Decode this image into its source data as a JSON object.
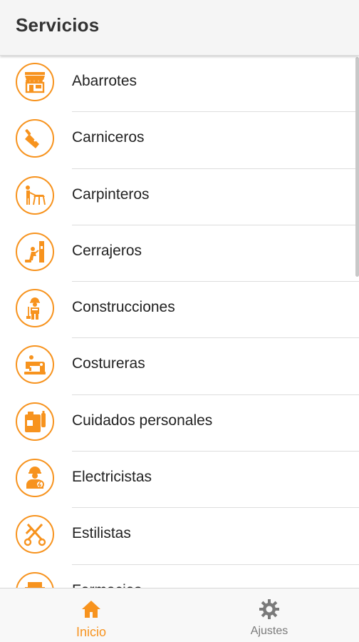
{
  "app": {
    "title": "Servicios"
  },
  "colors": {
    "accent": "#f7931e",
    "text": "#222222",
    "header_bg": "#f5f5f5",
    "muted": "#7a7a7a"
  },
  "services": [
    {
      "label": "Abarrotes",
      "icon": "store-icon"
    },
    {
      "label": "Carniceros",
      "icon": "cleaver-icon"
    },
    {
      "label": "Carpinteros",
      "icon": "carpenter-icon"
    },
    {
      "label": "Cerrajeros",
      "icon": "locksmith-icon"
    },
    {
      "label": "Construcciones",
      "icon": "construction-worker-icon"
    },
    {
      "label": "Costureras",
      "icon": "sewing-machine-icon"
    },
    {
      "label": "Cuidados personales",
      "icon": "personal-care-icon"
    },
    {
      "label": "Electricistas",
      "icon": "electrician-icon"
    },
    {
      "label": "Estilistas",
      "icon": "scissors-comb-icon"
    },
    {
      "label": "Farmacias",
      "icon": "pharmacy-icon"
    }
  ],
  "tabs": [
    {
      "label": "Inicio",
      "icon": "home-icon",
      "active": true
    },
    {
      "label": "Ajustes",
      "icon": "gear-icon",
      "active": false
    }
  ]
}
